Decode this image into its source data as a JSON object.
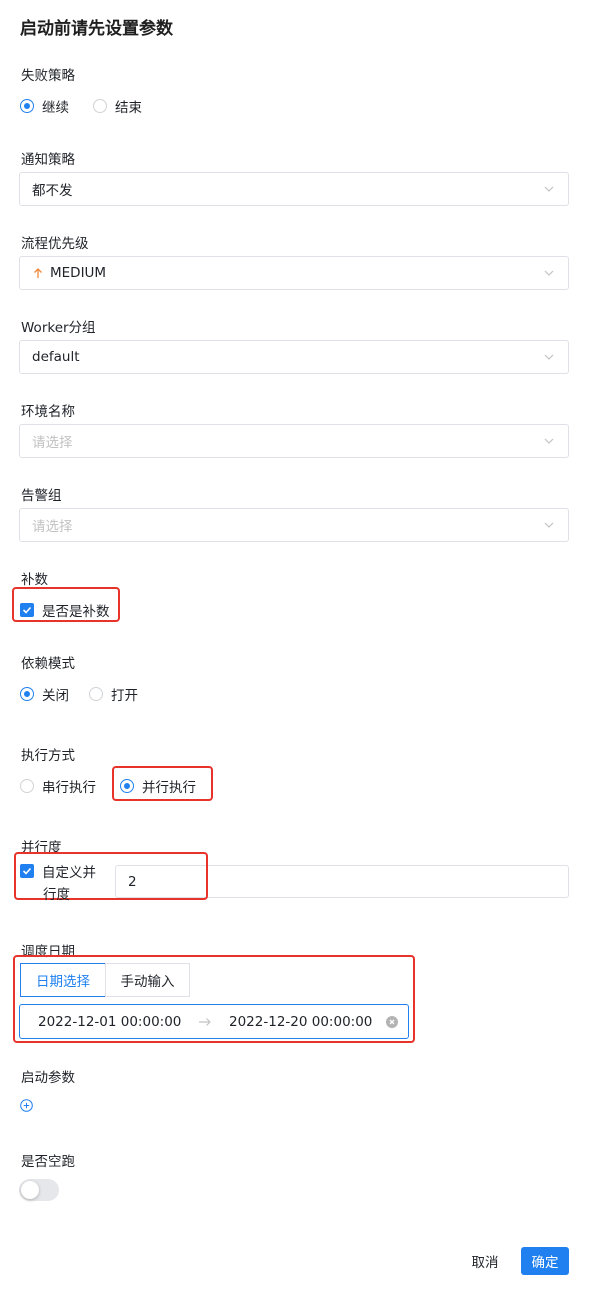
{
  "title": "启动前请先设置参数",
  "failure_strategy": {
    "label": "失败策略",
    "options": [
      "继续",
      "结束"
    ],
    "selected": "继续"
  },
  "notify_strategy": {
    "label": "通知策略",
    "value": "都不发"
  },
  "priority": {
    "label": "流程优先级",
    "value": "MEDIUM",
    "color": "#f0883a"
  },
  "worker_group": {
    "label": "Worker分组",
    "value": "default"
  },
  "environment": {
    "label": "环境名称",
    "placeholder": "请选择"
  },
  "alert_group": {
    "label": "告警组",
    "placeholder": "请选择"
  },
  "complement": {
    "label": "补数",
    "checkbox_label": "是否是补数",
    "checked": true
  },
  "dependency_mode": {
    "label": "依赖模式",
    "options": [
      "关闭",
      "打开"
    ],
    "selected": "关闭"
  },
  "run_mode": {
    "label": "执行方式",
    "options": [
      "串行执行",
      "并行执行"
    ],
    "selected": "并行执行"
  },
  "parallelism": {
    "label": "并行度",
    "checkbox_label_line1": "自定义并",
    "checkbox_label_line2": "行度",
    "checked": true,
    "value": "2"
  },
  "schedule_date": {
    "label": "调度日期",
    "tabs": [
      "日期选择",
      "手动输入"
    ],
    "active_tab": "日期选择",
    "start": "2022-12-01 00:00:00",
    "end": "2022-12-20 00:00:00"
  },
  "startup_params": {
    "label": "启动参数"
  },
  "dry_run": {
    "label": "是否空跑",
    "enabled": false
  },
  "footer": {
    "cancel": "取消",
    "confirm": "确定"
  },
  "colors": {
    "primary": "#2080f0",
    "highlight": "#e8332a"
  }
}
